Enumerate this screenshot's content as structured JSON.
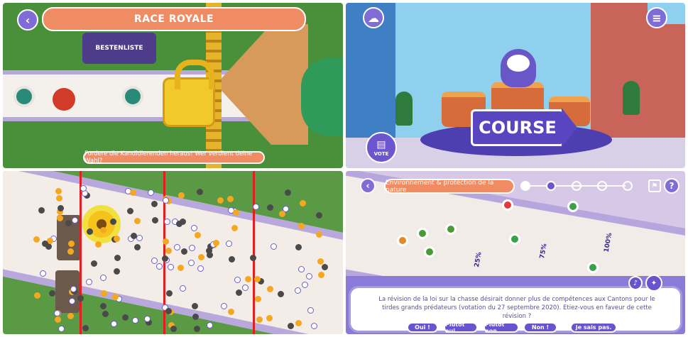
{
  "panel1": {
    "title": "RACE ROYALE",
    "leaderboard_label": "BESTENLISTE",
    "caption": "Fordere die Kandidierenden heraus! Wer verdient deine Wahl?",
    "back_icon": "chevron-left-icon"
  },
  "panel2": {
    "sign_label": "COURSE",
    "vote_label": "VOTE",
    "icons": [
      "thought-bubble-icon",
      "menu-icon",
      "book-icon"
    ]
  },
  "panel3": {
    "description": "top-down race track with crowd of characters and red checkpoint lines"
  },
  "panel4": {
    "category": "Environnement & protection de la nature",
    "percent_labels": [
      "25%",
      "75%",
      "100%"
    ],
    "question": "La révision de la loi sur la chasse désirait donner plus de compétences aux Cantons pour le tirdes grands prédateurs (votation du 27 septembre 2020). Etiez-vous en faveur de cette révision ?",
    "answers": [
      "Oui !",
      "Plutôt oui.",
      "Plutôt non.",
      "Non !",
      "Je sais pas."
    ],
    "help_label": "?",
    "icons": [
      "chevron-left-icon",
      "flag-icon",
      "help-icon",
      "music-note-icon",
      "lightbulb-icon"
    ]
  },
  "colors": {
    "accent_orange": "#f08c63",
    "accent_purple": "#6953cf",
    "checkpoint_red": "#e02020"
  }
}
